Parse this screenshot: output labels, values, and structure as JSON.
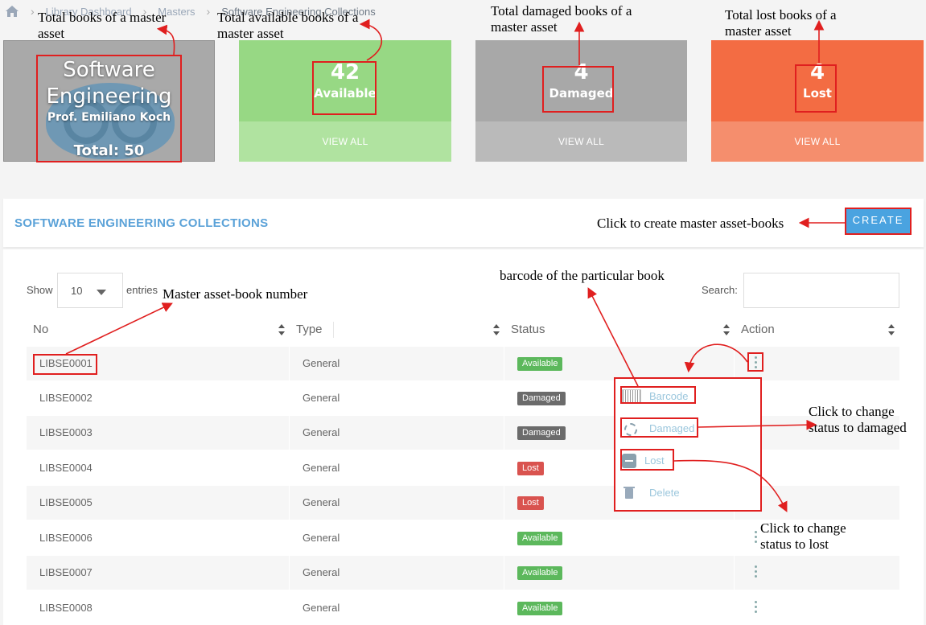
{
  "breadcrumb": [
    "Library Dashboard",
    "Masters",
    "Software Engineering Collections"
  ],
  "master_card": {
    "title_line1": "Software",
    "title_line2": "Engineering",
    "author": "Prof. Emiliano Koch",
    "total": "Total: 50"
  },
  "stats": [
    {
      "count": "42",
      "label": "Available",
      "link": "VIEW ALL"
    },
    {
      "count": "4",
      "label": "Damaged",
      "link": "VIEW ALL"
    },
    {
      "count": "4",
      "label": "Lost",
      "link": "VIEW ALL"
    }
  ],
  "panel": {
    "title": "SOFTWARE ENGINEERING COLLECTIONS",
    "create_label": "CREATE"
  },
  "controls": {
    "show": "Show",
    "entries_value": "10",
    "entries": "entries",
    "search_label": "Search:"
  },
  "columns": [
    "No",
    "Type",
    "Status",
    "Action"
  ],
  "rows": [
    {
      "no": "LIBSE0001",
      "type": "General",
      "status": "Available"
    },
    {
      "no": "LIBSE0002",
      "type": "General",
      "status": "Damaged"
    },
    {
      "no": "LIBSE0003",
      "type": "General",
      "status": "Damaged"
    },
    {
      "no": "LIBSE0004",
      "type": "General",
      "status": "Lost"
    },
    {
      "no": "LIBSE0005",
      "type": "General",
      "status": "Lost"
    },
    {
      "no": "LIBSE0006",
      "type": "General",
      "status": "Available"
    },
    {
      "no": "LIBSE0007",
      "type": "General",
      "status": "Available"
    },
    {
      "no": "LIBSE0008",
      "type": "General",
      "status": "Available"
    }
  ],
  "action_menu": [
    {
      "label": "Barcode",
      "icon": "barcode-icon"
    },
    {
      "label": "Damaged",
      "icon": "unlink-icon"
    },
    {
      "label": "Lost",
      "icon": "minus-square-icon"
    },
    {
      "label": "Delete",
      "icon": "trash-icon"
    }
  ],
  "annotations": {
    "total_books": "Total books of a master asset",
    "available_books": "Total available books of a master asset",
    "damaged_books": "Total damaged books of a master asset",
    "lost_books": "Total lost books of a master asset",
    "create": "Click to create master asset-books",
    "book_number": "Master asset-book number",
    "barcode": "barcode of the particular book",
    "to_damaged": "Click to change status to damaged",
    "to_lost": "Click to change status to lost"
  },
  "colors": {
    "available": "#97d884",
    "damaged": "#a8a8a8",
    "lost": "#f36c43",
    "accent": "#4aa3e0",
    "annotation": "#e01f1f"
  }
}
